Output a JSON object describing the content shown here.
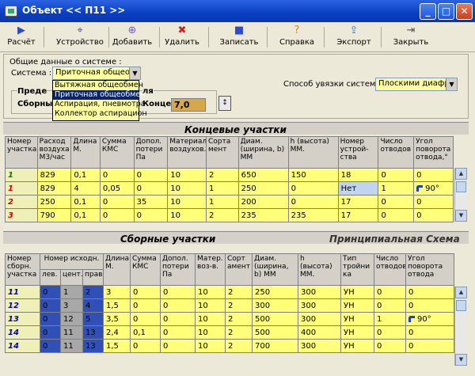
{
  "window": {
    "title": "Объект << П11 >>"
  },
  "toolbar": [
    {
      "name": "calc",
      "label": "Расчёт",
      "icon": "play-icon"
    },
    {
      "name": "device",
      "label": "Устройство",
      "icon": "network-icon"
    },
    {
      "name": "add",
      "label": "Добавить",
      "icon": "add-icon"
    },
    {
      "name": "delete",
      "label": "Удалить",
      "icon": "delete-icon"
    },
    {
      "name": "save",
      "label": "Записать",
      "icon": "floppy-icon"
    },
    {
      "name": "help",
      "label": "Справка",
      "icon": "help-icon"
    },
    {
      "name": "export",
      "label": "Экспорт",
      "icon": "export-icon"
    },
    {
      "name": "close",
      "label": "Закрыть",
      "icon": "exit-icon"
    }
  ],
  "system": {
    "group_title": "Общие данные о системе :",
    "system_label": "Система :",
    "system_value": "Приточная общеоб",
    "dropdown_options": [
      "Вытяжная  общеобмен",
      "Приточная общеобмен",
      "Аспирация, пневмотра",
      "Коллектор аспирацион"
    ],
    "dropdown_selected": 1,
    "inner_title_a": "Преде",
    "inner_title_b": "ля",
    "inner_label_a": "Сборны",
    "inner_label_b": "Концевых",
    "spin_value": "7,0",
    "binding_label": "Способ увязки  системы",
    "binding_value": "Плоскими диафр"
  },
  "end_sections": {
    "title": "Концевые участки",
    "headers": [
      "Номер участка",
      "Расход воздуха М3/час",
      "Длина М.",
      "Сумма КМС",
      "Допол. потери Па",
      "Материал воздухов.",
      "Сорта мент",
      "Диам. (ширина, b) ММ",
      "h (высота) ММ.",
      "Номер устрой-ства",
      "Число отводов",
      "Угол поворота отвода,°"
    ],
    "rows": [
      {
        "n": "1",
        "color": "green",
        "cells": [
          "829",
          "0,1",
          "0",
          "0",
          "10",
          "2",
          "650",
          "150",
          "18",
          "0",
          "0"
        ]
      },
      {
        "n": "1",
        "color": "red",
        "cells": [
          "829",
          "4",
          "0,05",
          "0",
          "10",
          "1",
          "250",
          "0",
          "Нет",
          "1",
          "90°"
        ]
      },
      {
        "n": "2",
        "color": "red",
        "cells": [
          "250",
          "0,1",
          "0",
          "35",
          "10",
          "1",
          "200",
          "0",
          "17",
          "0",
          "0"
        ]
      },
      {
        "n": "3",
        "color": "red",
        "cells": [
          "790",
          "0,1",
          "0",
          "0",
          "10",
          "2",
          "235",
          "235",
          "17",
          "0",
          "0"
        ]
      }
    ]
  },
  "collect_sections": {
    "title": "Сборные участки",
    "scheme_title": "Принципиальная Схема",
    "headers": [
      "Номер сборн. участка",
      "Номер исходн.",
      "Длина М.",
      "Сумма КМС",
      "Допол. потери Па",
      "Матер. воз-в.",
      "Сорт амент",
      "Диам. (ширина, b) ММ",
      "h (высота) ММ.",
      "Тип тройни ка",
      "Число отводов",
      "Угол поворота отвода"
    ],
    "sub_headers": [
      "лев.",
      "цент.",
      "прав."
    ],
    "rows": [
      {
        "n": "11",
        "cells": [
          "0",
          "1",
          "2",
          "3",
          "0",
          "0",
          "10",
          "2",
          "250",
          "300",
          "УН",
          "0",
          "0"
        ]
      },
      {
        "n": "12",
        "cells": [
          "0",
          "3",
          "4",
          "1,5",
          "0",
          "0",
          "10",
          "2",
          "300",
          "300",
          "УН",
          "0",
          "0"
        ]
      },
      {
        "n": "13",
        "cells": [
          "0",
          "12",
          "5",
          "3,5",
          "0",
          "0",
          "10",
          "2",
          "500",
          "300",
          "УН",
          "1",
          "90°"
        ]
      },
      {
        "n": "14",
        "cells": [
          "0",
          "11",
          "13",
          "2,4",
          "0,1",
          "0",
          "10",
          "2",
          "500",
          "400",
          "УН",
          "0",
          "0"
        ]
      },
      {
        "n": "14",
        "cells": [
          "0",
          "11",
          "13",
          "1,5",
          "0",
          "0",
          "10",
          "2",
          "700",
          "300",
          "УН",
          "0",
          "0"
        ]
      }
    ]
  }
}
